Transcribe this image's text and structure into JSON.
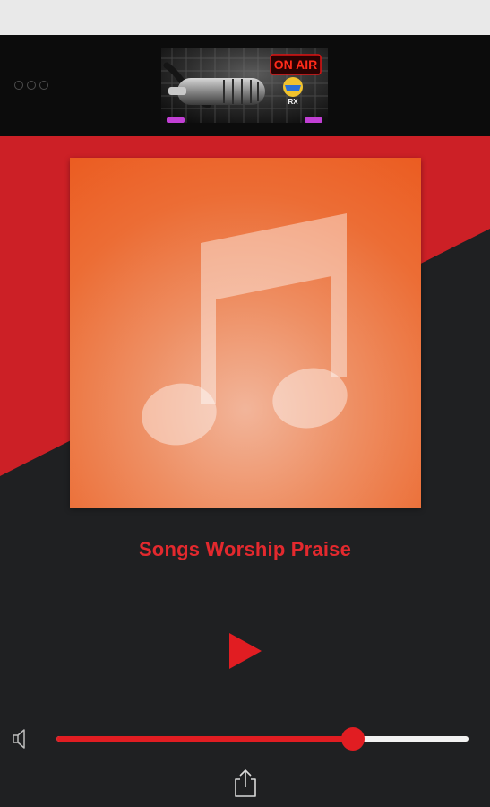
{
  "banner": {
    "on_air_text": "ON AIR"
  },
  "player": {
    "station_name": "Songs Worship Praise",
    "volume_level": 0.72
  },
  "colors": {
    "accent": "#e3292e",
    "dark_background": "#1f2022",
    "top_bar": "#0c0c0c",
    "artwork_orange": "#eb5c21"
  },
  "icons": {
    "artwork": "music-note-icon",
    "play": "play-icon",
    "volume": "speaker-icon",
    "share": "share-icon"
  }
}
